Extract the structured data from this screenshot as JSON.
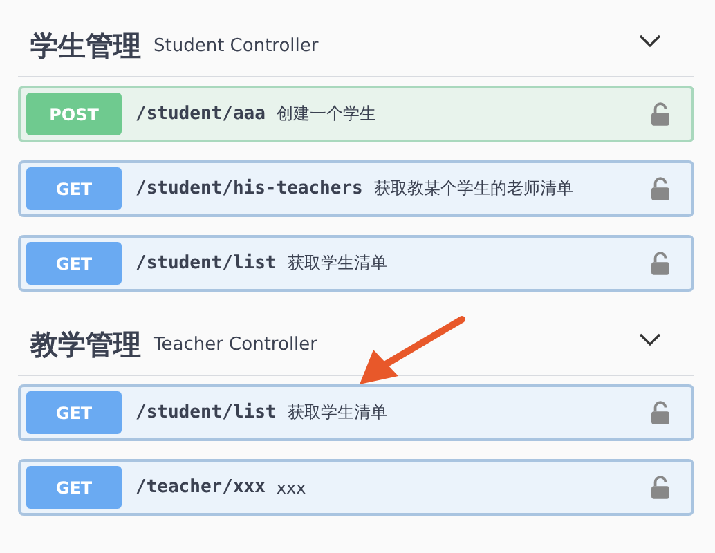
{
  "sections": [
    {
      "title": "学生管理",
      "subtitle": "Student Controller",
      "expanded": true,
      "operations": [
        {
          "kind": "post",
          "method": "POST",
          "path": "/student/aaa",
          "summary": "创建一个学生"
        },
        {
          "kind": "get",
          "method": "GET",
          "path": "/student/his-teachers",
          "summary": "获取教某个学生的老师清单"
        },
        {
          "kind": "get",
          "method": "GET",
          "path": "/student/list",
          "summary": "获取学生清单"
        }
      ]
    },
    {
      "title": "教学管理",
      "subtitle": "Teacher Controller",
      "expanded": true,
      "operations": [
        {
          "kind": "get",
          "method": "GET",
          "path": "/student/list",
          "summary": "获取学生清单"
        },
        {
          "kind": "get",
          "method": "GET",
          "path": "/teacher/xxx",
          "summary": "xxx"
        }
      ]
    }
  ]
}
